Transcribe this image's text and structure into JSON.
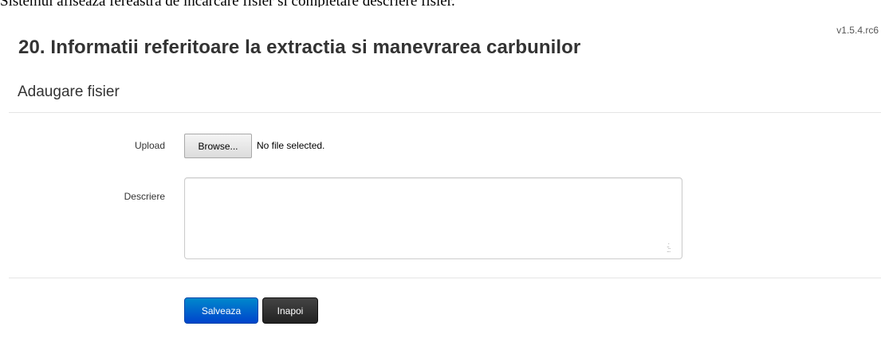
{
  "caption": "Sistemul afiseaza fereastra de incarcare fisier si completare descriere fisier.",
  "version": "v1.5.4.rc6",
  "page_title": "20. Informatii referitoare la extractia si manevrarea carbunilor",
  "subtitle": "Adaugare fisier",
  "form": {
    "upload_label": "Upload",
    "browse_label": "Browse...",
    "file_status": "No file selected.",
    "description_label": "Descriere",
    "description_value": ""
  },
  "actions": {
    "save_label": "Salveaza",
    "back_label": "Inapoi"
  },
  "colors": {
    "save_button": "#0055cc",
    "back_button": "#333333",
    "divider": "#e5e5e5"
  }
}
